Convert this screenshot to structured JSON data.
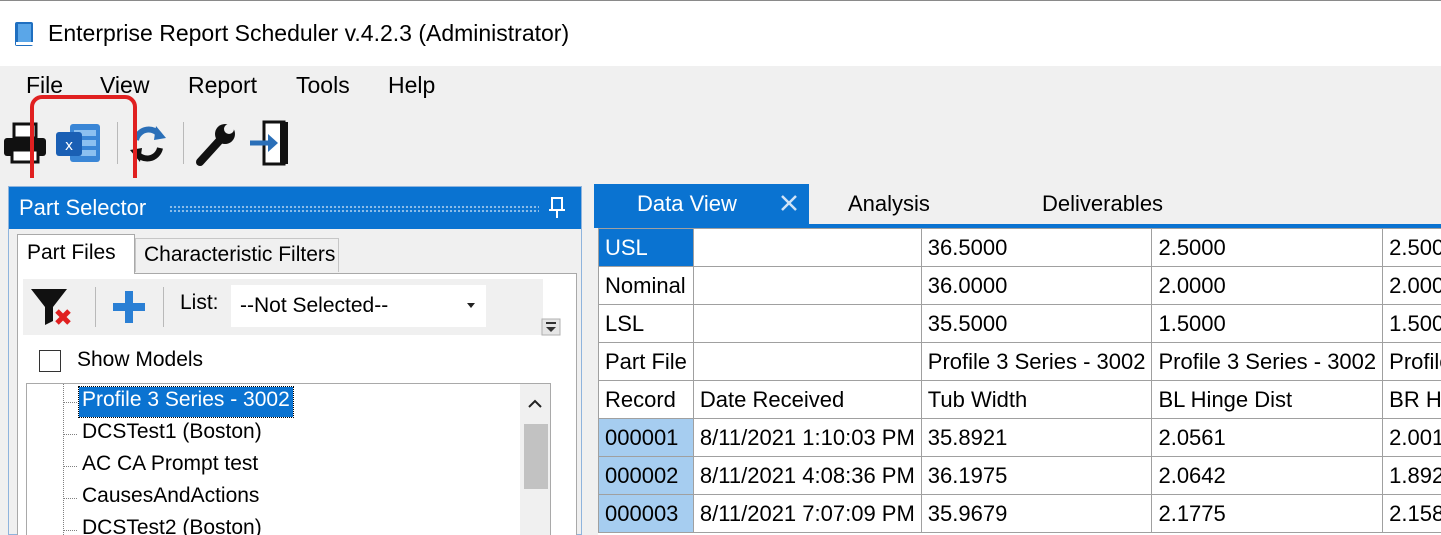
{
  "window": {
    "title": "Enterprise Report Scheduler v.4.2.3 (Administrator)",
    "icon": "app-book-icon"
  },
  "menu": {
    "items": [
      "File",
      "View",
      "Report",
      "Tools",
      "Help"
    ]
  },
  "toolbar": {
    "buttons": [
      {
        "name": "print",
        "icon": "printer-icon"
      },
      {
        "name": "export-excel",
        "icon": "excel-icon",
        "highlighted": true
      },
      {
        "name": "refresh",
        "icon": "refresh-icon"
      },
      {
        "name": "settings",
        "icon": "wrench-icon"
      },
      {
        "name": "exit",
        "icon": "exit-door-icon"
      }
    ],
    "highlight_color": "#e02020"
  },
  "part_selector": {
    "title": "Part Selector",
    "tabs": [
      "Part Files",
      "Characteristic Filters"
    ],
    "list_label": "List:",
    "list_value": "--Not Selected--",
    "show_models_label": "Show Models",
    "show_models_checked": false,
    "items": [
      "Profile 3 Series - 3002",
      "DCSTest1 (Boston)",
      "AC CA Prompt test",
      "CausesAndActions",
      "DCSTest2 (Boston)"
    ],
    "selected_index": 0
  },
  "tabs": {
    "items": [
      "Data View",
      "Analysis",
      "Deliverables"
    ],
    "active": "Data View"
  },
  "data_view": {
    "rows": [
      {
        "label": "USL",
        "date": "",
        "c1": "36.5000",
        "c2": "2.5000",
        "c3": "2.500"
      },
      {
        "label": "Nominal",
        "date": "",
        "c1": "36.0000",
        "c2": "2.0000",
        "c3": "2.000"
      },
      {
        "label": "LSL",
        "date": "",
        "c1": "35.5000",
        "c2": "1.5000",
        "c3": "1.500"
      },
      {
        "label": "Part File",
        "date": "",
        "c1": "Profile 3 Series - 3002",
        "c2": "Profile 3 Series - 3002",
        "c3": "Profile"
      },
      {
        "label": "Record",
        "date": "Date Received",
        "c1": "Tub Width",
        "c2": "BL Hinge Dist",
        "c3": "BR H"
      },
      {
        "label": "000001",
        "date": "8/11/2021 1:10:03 PM",
        "c1": "35.8921",
        "c2": "2.0561",
        "c3": "2.001"
      },
      {
        "label": "000002",
        "date": "8/11/2021 4:08:36 PM",
        "c1": "36.1975",
        "c2": "2.0642",
        "c3": "1.892"
      },
      {
        "label": "000003",
        "date": "8/11/2021 7:07:09 PM",
        "c1": "35.9679",
        "c2": "2.1775",
        "c3": "2.158"
      }
    ]
  },
  "colors": {
    "accent": "#0a73d1",
    "record_cell": "#a6cdf0",
    "panel_bg": "#f0f0f0"
  }
}
